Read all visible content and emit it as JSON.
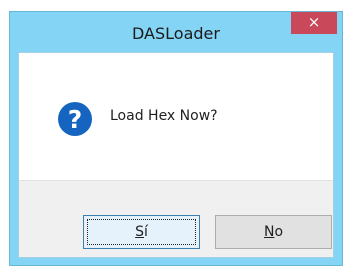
{
  "dialog": {
    "title": "DASLoader",
    "close_symbol": "×",
    "icon": "question-icon",
    "message": "Load Hex Now?"
  },
  "buttons": {
    "yes": {
      "mnemonic": "S",
      "rest": "í"
    },
    "no": {
      "mnemonic": "N",
      "rest": "o"
    }
  },
  "colors": {
    "frame": "#83d4f5",
    "close": "#c9485a",
    "icon": "#1565c0"
  }
}
